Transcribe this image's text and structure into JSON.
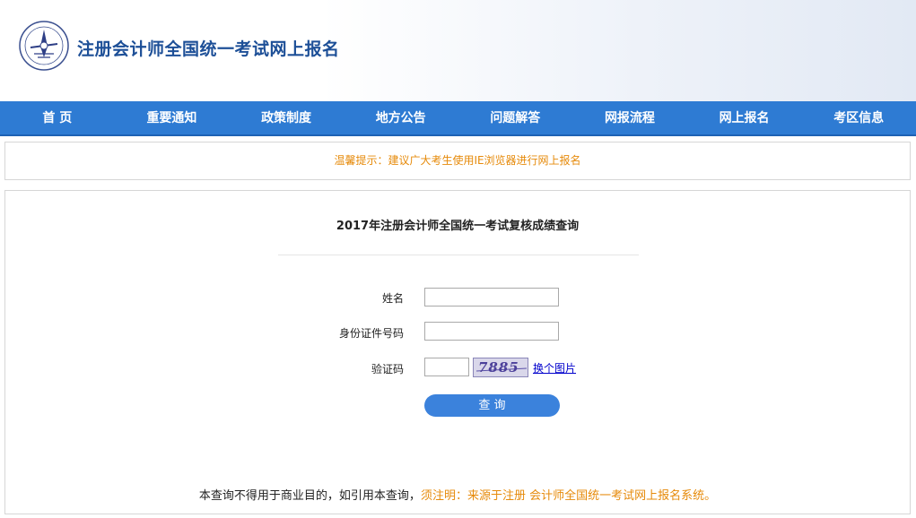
{
  "header": {
    "title": "注册会计师全国统一考试网上报名",
    "logo_icon": "cicpa-seal-icon"
  },
  "nav": {
    "items": [
      {
        "label": "首 页"
      },
      {
        "label": "重要通知"
      },
      {
        "label": "政策制度"
      },
      {
        "label": "地方公告"
      },
      {
        "label": "问题解答"
      },
      {
        "label": "网报流程"
      },
      {
        "label": "网上报名"
      },
      {
        "label": "考区信息"
      }
    ],
    "bg_color": "#2e7bd3"
  },
  "notice": {
    "text": "温馨提示：建议广大考生使用IE浏览器进行网上报名",
    "color": "#e68a0a"
  },
  "query": {
    "title": "2017年注册会计师全国统一考试复核成绩查询",
    "name_label": "姓名",
    "name_value": "",
    "id_label": "身份证件号码",
    "id_value": "",
    "captcha_label": "验证码",
    "captcha_value": "",
    "captcha_text": "7885",
    "refresh_link": "换个图片",
    "submit_label": "查 询"
  },
  "footer": {
    "note_plain": "本查询不得用于商业目的，如引用本查询，",
    "note_highlight": "须注明：来源于注册 会计师全国统一考试网上报名系统。"
  }
}
